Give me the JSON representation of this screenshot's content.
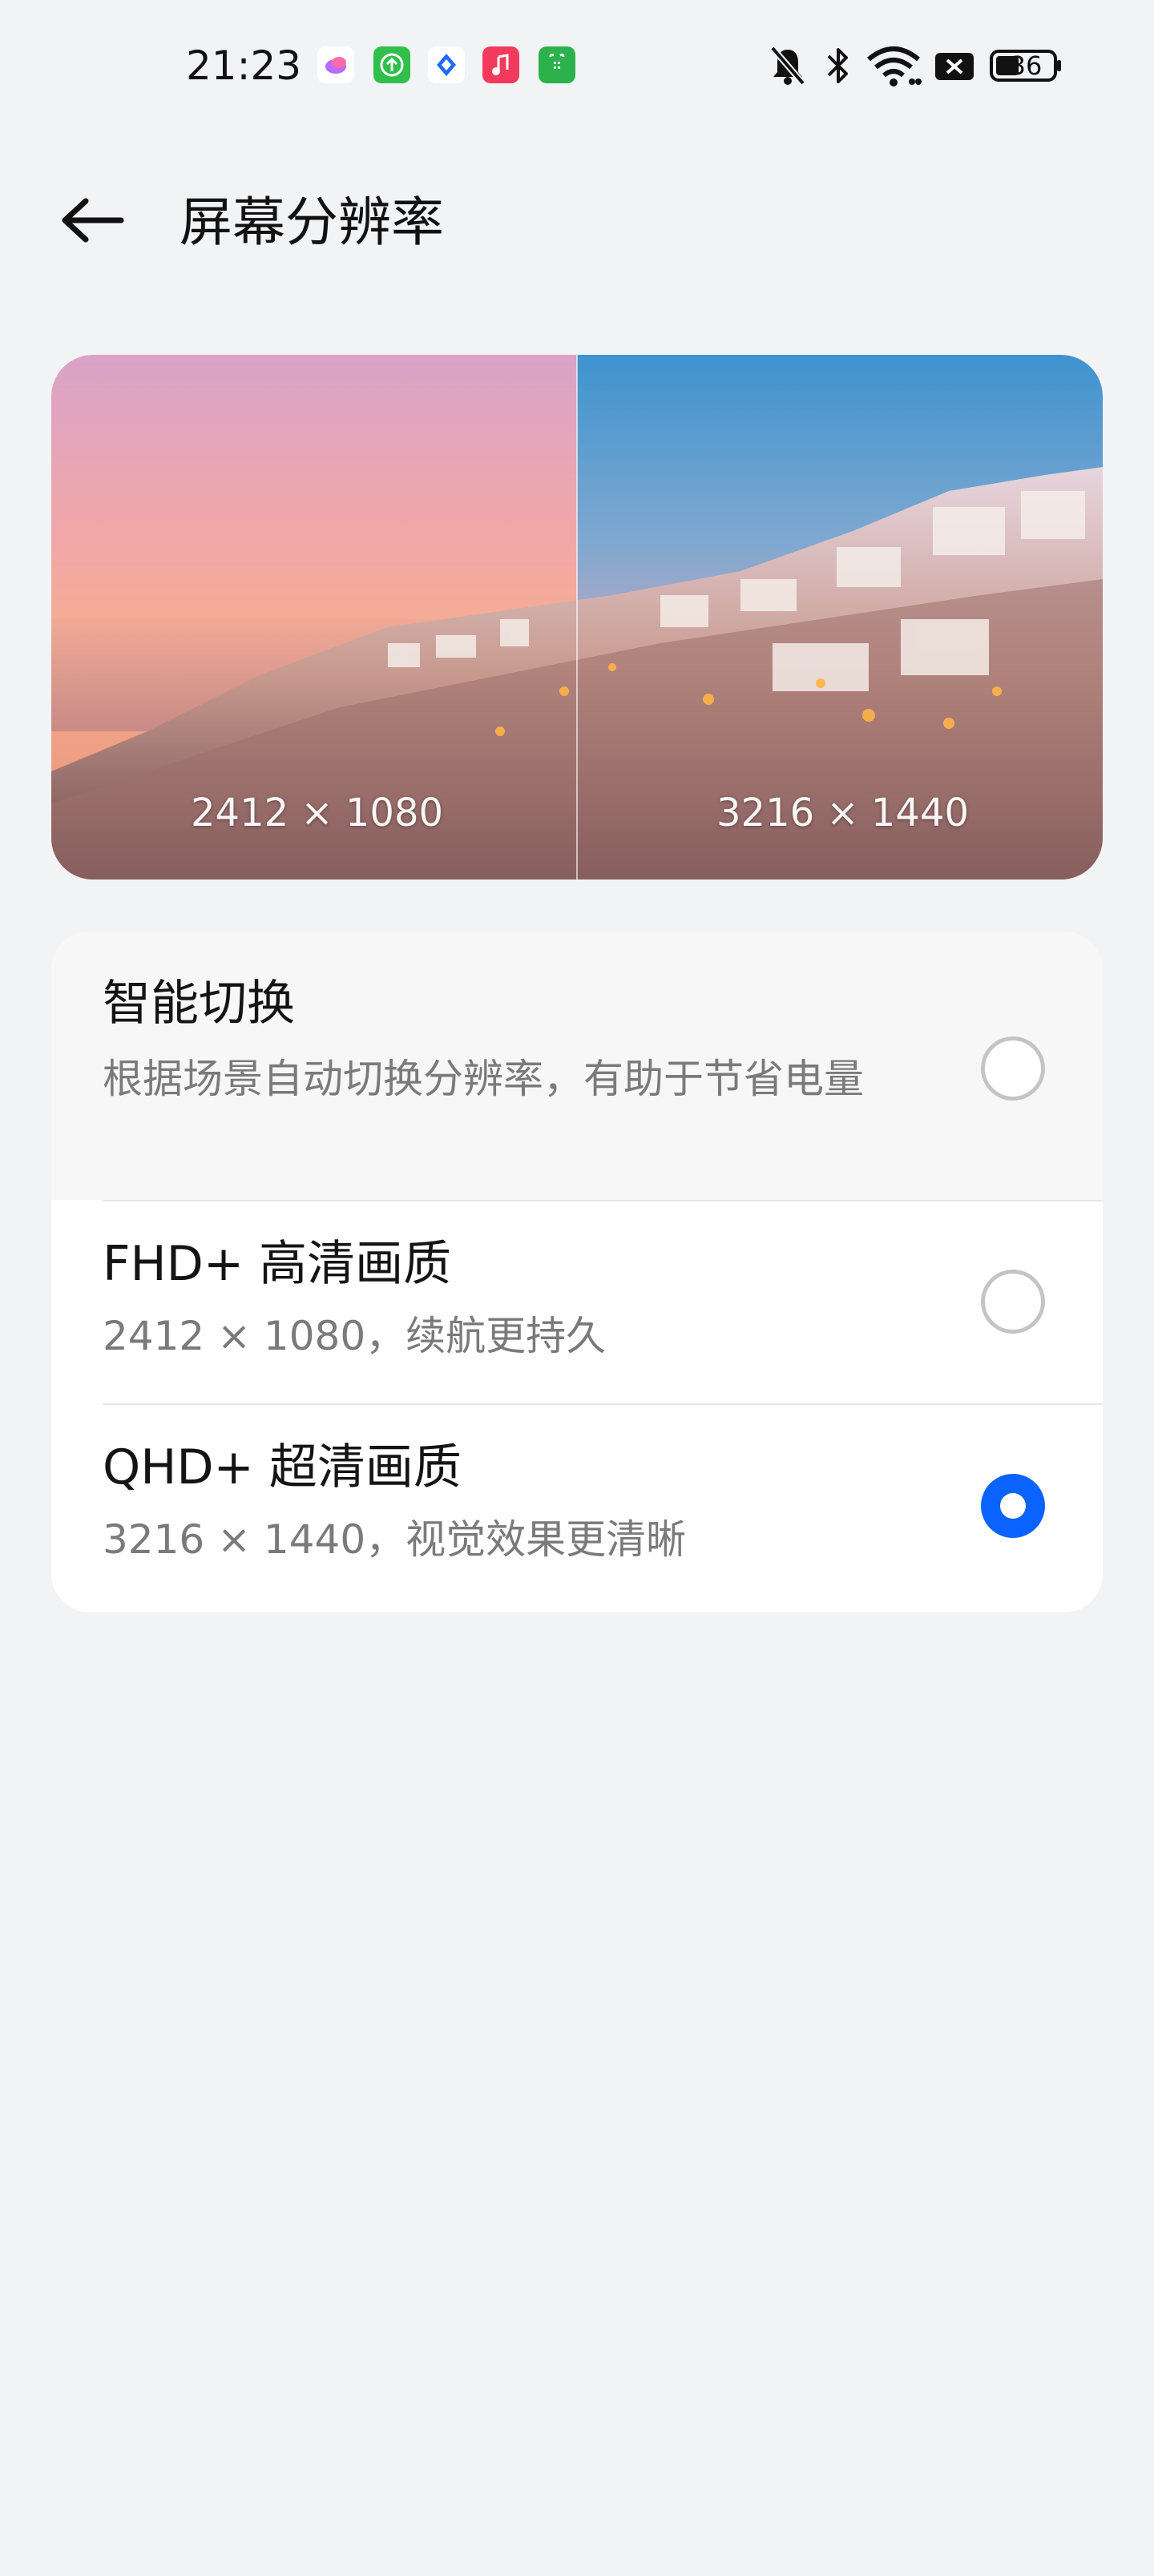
{
  "status_bar": {
    "time": "21:23",
    "battery": "36",
    "notification_icons": [
      "cloud-app-icon",
      "upload-app-icon",
      "browser-app-icon",
      "music-app-icon",
      "store-app-icon"
    ],
    "system_icons": [
      "bell-off-icon",
      "bluetooth-icon",
      "wifi-icon",
      "sim-off-icon",
      "battery-icon"
    ]
  },
  "header": {
    "title": "屏幕分辨率",
    "back_icon": "arrow-left-icon"
  },
  "preview": {
    "left_label": "2412 × 1080",
    "right_label": "3216 × 1440"
  },
  "options": [
    {
      "title": "智能切换",
      "description": "根据场景自动切换分辨率，有助于节省电量",
      "selected": false
    },
    {
      "title": "FHD+ 高清画质",
      "description": "2412 × 1080，续航更持久",
      "selected": false
    },
    {
      "title": "QHD+ 超清画质",
      "description": "3216 × 1440，视觉效果更清晰",
      "selected": true
    }
  ],
  "colors": {
    "accent": "#0a63ff",
    "background": "#f2f3f5",
    "card": "#ffffff",
    "highlight_row": "#f7f7f8",
    "secondary_text": "#7a7a7a"
  }
}
